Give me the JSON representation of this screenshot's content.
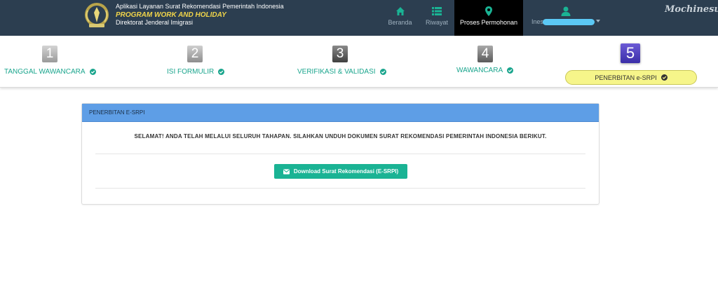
{
  "header": {
    "app_line1": "Aplikasi Layanan Surat Rekomendasi Pemerintah Indonesia",
    "app_line2": "PROGRAM WORK AND HOLIDAY",
    "app_line3": "Direktorat Jenderal Imigrasi",
    "nav": {
      "beranda": "Beranda",
      "riwayat": "Riwayat",
      "proses": "Proses Permohonan"
    },
    "user_prefix": "Ines",
    "watermark": "Mochinesu"
  },
  "steps": [
    {
      "num": "1",
      "label": "TANGGAL WAWANCARA",
      "done": true
    },
    {
      "num": "2",
      "label": "ISI FORMULIR",
      "done": true
    },
    {
      "num": "3",
      "label": "VERIFIKASI & VALIDASI",
      "done": true
    },
    {
      "num": "4",
      "label": "WAWANCARA",
      "done": true
    },
    {
      "num": "5",
      "label": "PENERBITAN e-SRPI",
      "done": true,
      "active": true
    }
  ],
  "panel": {
    "title": "PENERBITAN E-SRPI",
    "message": "SELAMAT! ANDA TELAH MELALUI SELURUH TAHAPAN. SILAHKAN UNDUH DOKUMEN SURAT REKOMENDASI PEMERINTAH INDONESIA BERIKUT.",
    "download_label": "Download Surat Rekomendasi (E-SRPI)"
  },
  "colors": {
    "navbar": "#2c3e50",
    "accent": "#1ab394",
    "panel_header": "#5e9ee6",
    "active_step": "#f6f58a",
    "brand_yellow": "#f1d54a"
  }
}
